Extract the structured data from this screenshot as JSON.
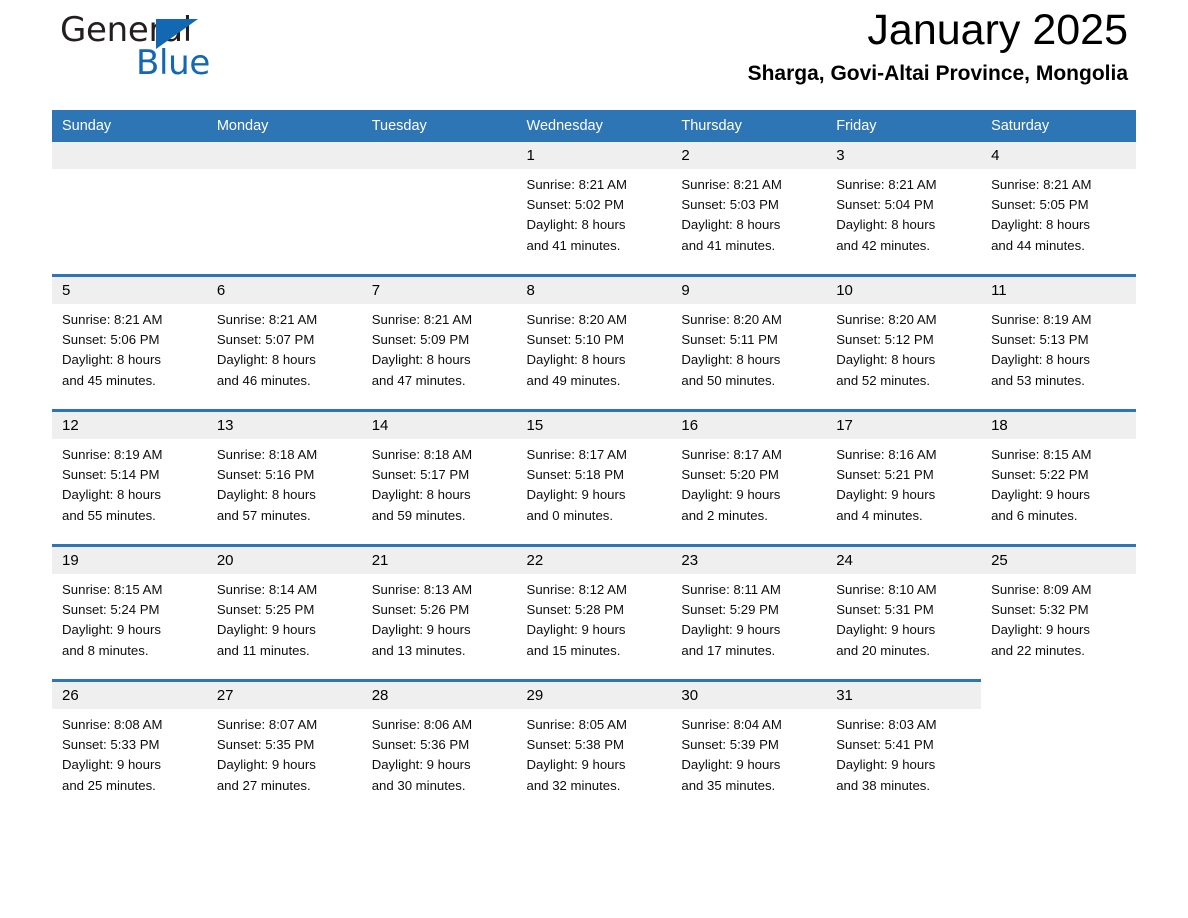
{
  "brand": {
    "name_part1": "General",
    "name_part2": "Blue",
    "accent_color": "#1268b3",
    "logo_icon": "triangle-flag-icon"
  },
  "header": {
    "title": "January 2025",
    "subtitle": "Sharga, Govi-Altai Province, Mongolia"
  },
  "calendar": {
    "header_bg": "#2E75B6",
    "daynum_bg": "#EFEFEF",
    "weekday_headers": [
      "Sunday",
      "Monday",
      "Tuesday",
      "Wednesday",
      "Thursday",
      "Friday",
      "Saturday"
    ],
    "weeks": [
      [
        {
          "day": "",
          "lines": []
        },
        {
          "day": "",
          "lines": []
        },
        {
          "day": "",
          "lines": []
        },
        {
          "day": "1",
          "lines": [
            "Sunrise: 8:21 AM",
            "Sunset: 5:02 PM",
            "Daylight: 8 hours",
            "and 41 minutes."
          ]
        },
        {
          "day": "2",
          "lines": [
            "Sunrise: 8:21 AM",
            "Sunset: 5:03 PM",
            "Daylight: 8 hours",
            "and 41 minutes."
          ]
        },
        {
          "day": "3",
          "lines": [
            "Sunrise: 8:21 AM",
            "Sunset: 5:04 PM",
            "Daylight: 8 hours",
            "and 42 minutes."
          ]
        },
        {
          "day": "4",
          "lines": [
            "Sunrise: 8:21 AM",
            "Sunset: 5:05 PM",
            "Daylight: 8 hours",
            "and 44 minutes."
          ]
        }
      ],
      [
        {
          "day": "5",
          "lines": [
            "Sunrise: 8:21 AM",
            "Sunset: 5:06 PM",
            "Daylight: 8 hours",
            "and 45 minutes."
          ]
        },
        {
          "day": "6",
          "lines": [
            "Sunrise: 8:21 AM",
            "Sunset: 5:07 PM",
            "Daylight: 8 hours",
            "and 46 minutes."
          ]
        },
        {
          "day": "7",
          "lines": [
            "Sunrise: 8:21 AM",
            "Sunset: 5:09 PM",
            "Daylight: 8 hours",
            "and 47 minutes."
          ]
        },
        {
          "day": "8",
          "lines": [
            "Sunrise: 8:20 AM",
            "Sunset: 5:10 PM",
            "Daylight: 8 hours",
            "and 49 minutes."
          ]
        },
        {
          "day": "9",
          "lines": [
            "Sunrise: 8:20 AM",
            "Sunset: 5:11 PM",
            "Daylight: 8 hours",
            "and 50 minutes."
          ]
        },
        {
          "day": "10",
          "lines": [
            "Sunrise: 8:20 AM",
            "Sunset: 5:12 PM",
            "Daylight: 8 hours",
            "and 52 minutes."
          ]
        },
        {
          "day": "11",
          "lines": [
            "Sunrise: 8:19 AM",
            "Sunset: 5:13 PM",
            "Daylight: 8 hours",
            "and 53 minutes."
          ]
        }
      ],
      [
        {
          "day": "12",
          "lines": [
            "Sunrise: 8:19 AM",
            "Sunset: 5:14 PM",
            "Daylight: 8 hours",
            "and 55 minutes."
          ]
        },
        {
          "day": "13",
          "lines": [
            "Sunrise: 8:18 AM",
            "Sunset: 5:16 PM",
            "Daylight: 8 hours",
            "and 57 minutes."
          ]
        },
        {
          "day": "14",
          "lines": [
            "Sunrise: 8:18 AM",
            "Sunset: 5:17 PM",
            "Daylight: 8 hours",
            "and 59 minutes."
          ]
        },
        {
          "day": "15",
          "lines": [
            "Sunrise: 8:17 AM",
            "Sunset: 5:18 PM",
            "Daylight: 9 hours",
            "and 0 minutes."
          ]
        },
        {
          "day": "16",
          "lines": [
            "Sunrise: 8:17 AM",
            "Sunset: 5:20 PM",
            "Daylight: 9 hours",
            "and 2 minutes."
          ]
        },
        {
          "day": "17",
          "lines": [
            "Sunrise: 8:16 AM",
            "Sunset: 5:21 PM",
            "Daylight: 9 hours",
            "and 4 minutes."
          ]
        },
        {
          "day": "18",
          "lines": [
            "Sunrise: 8:15 AM",
            "Sunset: 5:22 PM",
            "Daylight: 9 hours",
            "and 6 minutes."
          ]
        }
      ],
      [
        {
          "day": "19",
          "lines": [
            "Sunrise: 8:15 AM",
            "Sunset: 5:24 PM",
            "Daylight: 9 hours",
            "and 8 minutes."
          ]
        },
        {
          "day": "20",
          "lines": [
            "Sunrise: 8:14 AM",
            "Sunset: 5:25 PM",
            "Daylight: 9 hours",
            "and 11 minutes."
          ]
        },
        {
          "day": "21",
          "lines": [
            "Sunrise: 8:13 AM",
            "Sunset: 5:26 PM",
            "Daylight: 9 hours",
            "and 13 minutes."
          ]
        },
        {
          "day": "22",
          "lines": [
            "Sunrise: 8:12 AM",
            "Sunset: 5:28 PM",
            "Daylight: 9 hours",
            "and 15 minutes."
          ]
        },
        {
          "day": "23",
          "lines": [
            "Sunrise: 8:11 AM",
            "Sunset: 5:29 PM",
            "Daylight: 9 hours",
            "and 17 minutes."
          ]
        },
        {
          "day": "24",
          "lines": [
            "Sunrise: 8:10 AM",
            "Sunset: 5:31 PM",
            "Daylight: 9 hours",
            "and 20 minutes."
          ]
        },
        {
          "day": "25",
          "lines": [
            "Sunrise: 8:09 AM",
            "Sunset: 5:32 PM",
            "Daylight: 9 hours",
            "and 22 minutes."
          ]
        }
      ],
      [
        {
          "day": "26",
          "lines": [
            "Sunrise: 8:08 AM",
            "Sunset: 5:33 PM",
            "Daylight: 9 hours",
            "and 25 minutes."
          ]
        },
        {
          "day": "27",
          "lines": [
            "Sunrise: 8:07 AM",
            "Sunset: 5:35 PM",
            "Daylight: 9 hours",
            "and 27 minutes."
          ]
        },
        {
          "day": "28",
          "lines": [
            "Sunrise: 8:06 AM",
            "Sunset: 5:36 PM",
            "Daylight: 9 hours",
            "and 30 minutes."
          ]
        },
        {
          "day": "29",
          "lines": [
            "Sunrise: 8:05 AM",
            "Sunset: 5:38 PM",
            "Daylight: 9 hours",
            "and 32 minutes."
          ]
        },
        {
          "day": "30",
          "lines": [
            "Sunrise: 8:04 AM",
            "Sunset: 5:39 PM",
            "Daylight: 9 hours",
            "and 35 minutes."
          ]
        },
        {
          "day": "31",
          "lines": [
            "Sunrise: 8:03 AM",
            "Sunset: 5:41 PM",
            "Daylight: 9 hours",
            "and 38 minutes."
          ]
        },
        {
          "day": "",
          "lines": []
        }
      ]
    ]
  }
}
